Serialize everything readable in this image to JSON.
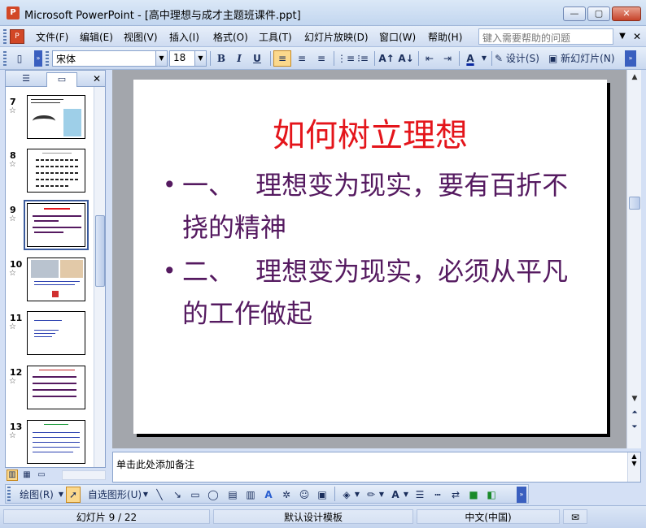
{
  "window": {
    "title": "Microsoft PowerPoint - [高中理想与成才主题班课件.ppt]",
    "min_label": "—",
    "max_label": "▢",
    "close_label": "✕"
  },
  "menu": {
    "items": [
      "文件(F)",
      "编辑(E)",
      "视图(V)",
      "插入(I)",
      "格式(O)",
      "工具(T)",
      "幻灯片放映(D)",
      "窗口(W)",
      "帮助(H)"
    ],
    "help_placeholder": "键入需要帮助的问题"
  },
  "toolbar": {
    "font_name": "宋体",
    "font_size": "18",
    "bold": "B",
    "italic": "I",
    "underline": "U",
    "font_color_label": "A",
    "design_label": "设计(S)",
    "new_slide_label": "新幻灯片(N)"
  },
  "panel": {
    "tab_outline": "☰",
    "tab_slides": "▭",
    "close": "✕",
    "slides": [
      {
        "number": "7"
      },
      {
        "number": "8"
      },
      {
        "number": "9",
        "selected": true
      },
      {
        "number": "10"
      },
      {
        "number": "11"
      },
      {
        "number": "12"
      },
      {
        "number": "13"
      }
    ],
    "star": "☆"
  },
  "slide": {
    "title": "如何树立理想",
    "bullet_glyph": "•",
    "bullets": [
      "一、　 理想变为现实，要有百折不挠的精神",
      "二、　 理想变为现实，必须从平凡的工作做起"
    ]
  },
  "notes": {
    "placeholder": "单击此处添加备注"
  },
  "drawbar": {
    "draw_label": "绘图(R)",
    "autoshape_label": "自选图形(U)"
  },
  "status": {
    "slide_info": "幻灯片 9 / 22",
    "template": "默认设计模板",
    "language": "中文(中国)"
  },
  "colors": {
    "title_red": "#e4151b",
    "bullet_purple": "#551a60",
    "accent_orange": "#fbd88c"
  }
}
